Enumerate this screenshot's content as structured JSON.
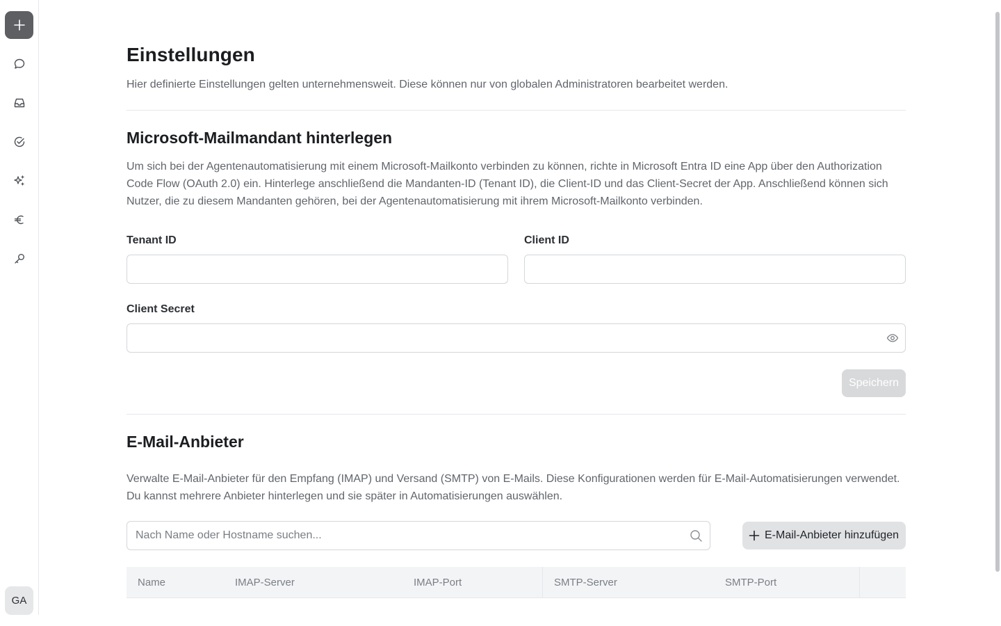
{
  "sidebar": {
    "new_button": "new-chat",
    "icons": [
      "chat-bubble-icon",
      "inbox-icon",
      "check-circle-icon",
      "sparkles-icon",
      "euro-icon",
      "key-icon"
    ],
    "avatar_initials": "GA"
  },
  "page": {
    "title": "Einstellungen",
    "description": "Hier definierte Einstellungen gelten unternehmensweit. Diese können nur von globalen Administratoren bearbeitet werden."
  },
  "microsoft": {
    "title": "Microsoft-Mailmandant hinterlegen",
    "description": "Um sich bei der Agentenautomatisierung mit einem Microsoft-Mailkonto verbinden zu können, richte in Microsoft Entra ID eine App über den Authorization Code Flow (OAuth 2.0) ein. Hinterlege anschließend die Mandanten-ID (Tenant ID), die Client-ID und das Client-Secret der App. Anschließend können sich Nutzer, die zu diesem Mandanten gehören, bei der Agentenautomatisierung mit ihrem Microsoft-Mailkonto verbinden.",
    "tenant_label": "Tenant ID",
    "tenant_value": "",
    "client_id_label": "Client ID",
    "client_id_value": "",
    "client_secret_label": "Client Secret",
    "client_secret_value": "",
    "save_label": "Speichern"
  },
  "providers": {
    "title": "E-Mail-Anbieter",
    "description": "Verwalte E-Mail-Anbieter für den Empfang (IMAP) und Versand (SMTP) von E-Mails. Diese Konfigurationen werden für E-Mail-Automatisierungen verwendet. Du kannst mehrere Anbieter hinterlegen und sie später in Automatisierungen auswählen.",
    "search_placeholder": "Nach Name oder Hostname suchen...",
    "add_label": "E-Mail-Anbieter hinzufügen",
    "columns": [
      "Name",
      "IMAP-Server",
      "IMAP-Port",
      "SMTP-Server",
      "SMTP-Port",
      ""
    ]
  },
  "colors": {
    "accent_dark": "#5d5f63",
    "disabled_button": "#d8d9db",
    "table_header_bg": "#f3f4f6"
  }
}
